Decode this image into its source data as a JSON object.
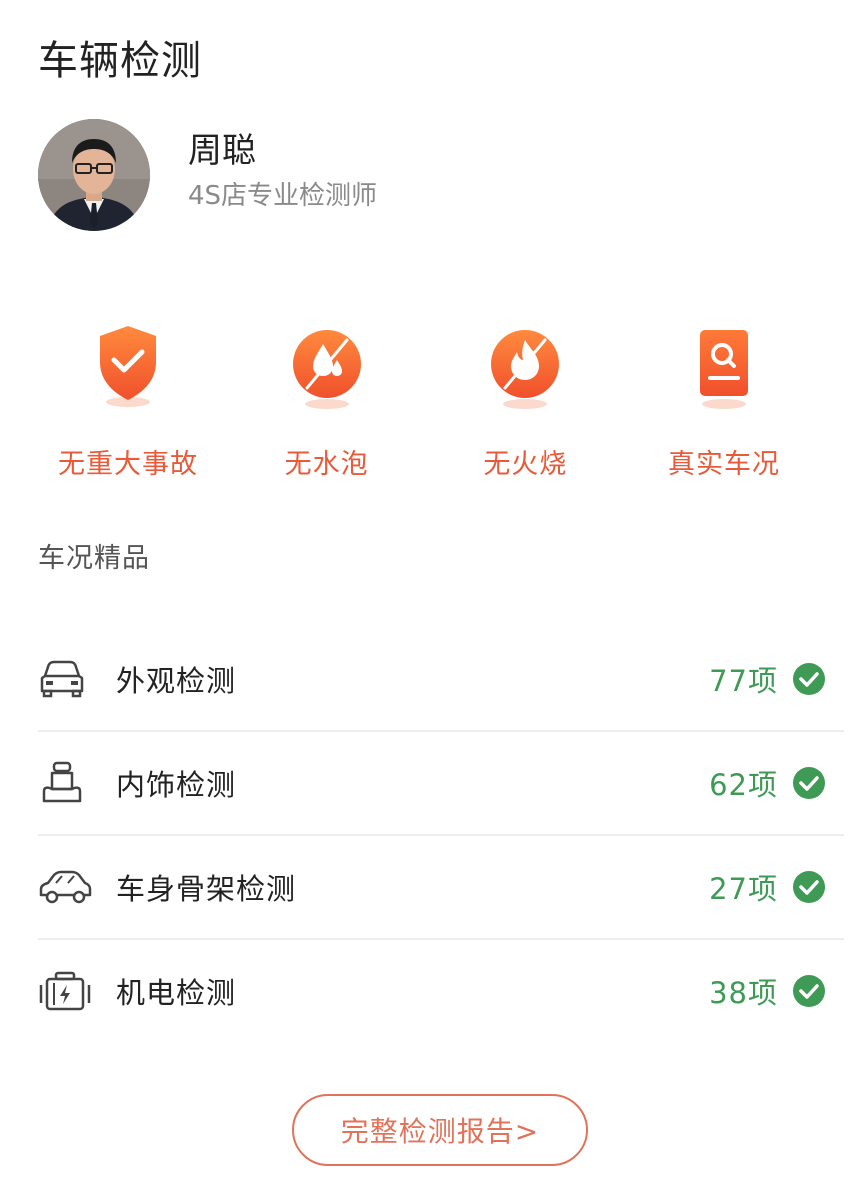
{
  "page": {
    "title": "车辆检测"
  },
  "inspector": {
    "name": "周聪",
    "title": "4S店专业检测师",
    "avatar_icon": "inspector-photo"
  },
  "badges": [
    {
      "label": "无重大事故",
      "icon": "shield-check-icon"
    },
    {
      "label": "无水泡",
      "icon": "no-water-icon"
    },
    {
      "label": "无火烧",
      "icon": "no-fire-icon"
    },
    {
      "label": "真实车况",
      "icon": "report-search-icon"
    }
  ],
  "section": {
    "title": "车况精品"
  },
  "checks": [
    {
      "label": "外观检测",
      "count": "77项",
      "icon": "car-front-icon"
    },
    {
      "label": "内饰检测",
      "count": "62项",
      "icon": "car-seat-icon"
    },
    {
      "label": "车身骨架检测",
      "count": "27项",
      "icon": "car-body-icon"
    },
    {
      "label": "机电检测",
      "count": "38项",
      "icon": "battery-icon"
    }
  ],
  "report_button": {
    "label": "完整检测报告>"
  },
  "colors": {
    "accent": "#e85a3a",
    "success": "#3e9a55",
    "button_border": "#e0735a"
  }
}
